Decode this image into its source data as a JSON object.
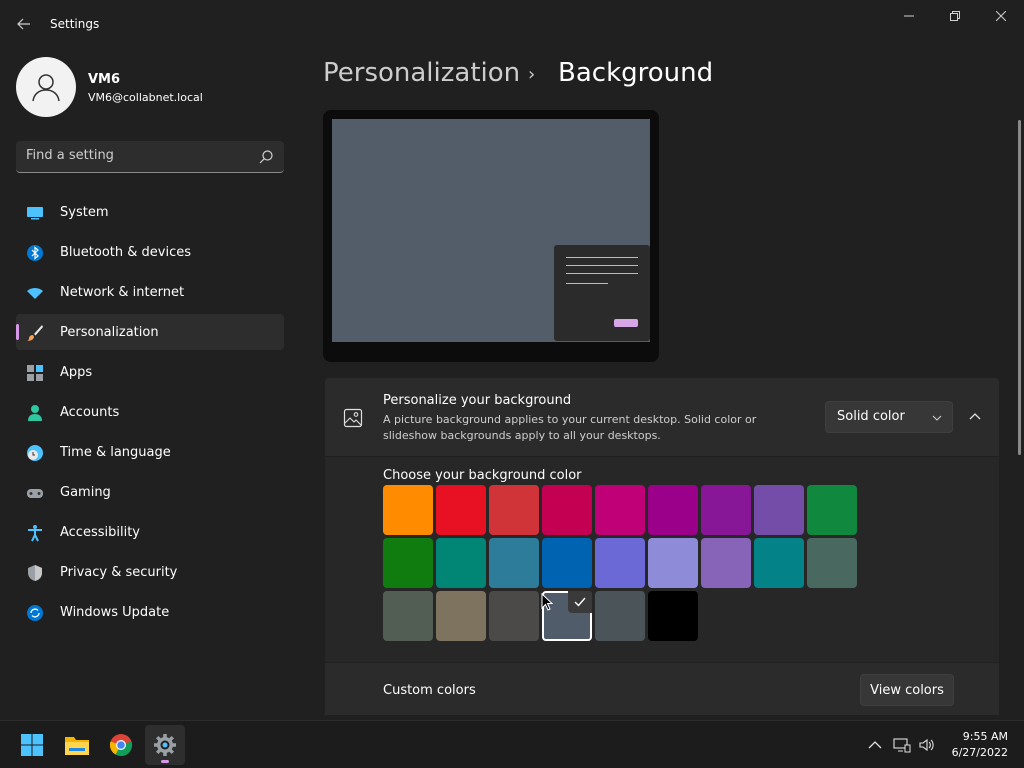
{
  "window": {
    "title": "Settings",
    "back_label": "←"
  },
  "user": {
    "name": "VM6",
    "email": "VM6@collabnet.local"
  },
  "search": {
    "placeholder": "Find a setting"
  },
  "nav": {
    "items": [
      {
        "label": "System",
        "icon": "system-icon"
      },
      {
        "label": "Bluetooth & devices",
        "icon": "bluetooth-icon"
      },
      {
        "label": "Network & internet",
        "icon": "network-icon"
      },
      {
        "label": "Personalization",
        "icon": "brush-icon",
        "active": true
      },
      {
        "label": "Apps",
        "icon": "apps-icon"
      },
      {
        "label": "Accounts",
        "icon": "accounts-icon"
      },
      {
        "label": "Time & language",
        "icon": "time-icon"
      },
      {
        "label": "Gaming",
        "icon": "gaming-icon"
      },
      {
        "label": "Accessibility",
        "icon": "accessibility-icon"
      },
      {
        "label": "Privacy & security",
        "icon": "shield-icon"
      },
      {
        "label": "Windows Update",
        "icon": "update-icon"
      }
    ]
  },
  "breadcrumb": {
    "parent": "Personalization",
    "separator": "›",
    "current": "Background"
  },
  "preview": {
    "background_color": "#525d69"
  },
  "background_card": {
    "title": "Personalize your background",
    "description": "A picture background applies to your current desktop. Solid color or slideshow backgrounds apply to all your desktops.",
    "dropdown_value": "Solid color",
    "choose_label": "Choose your background color",
    "colors": [
      [
        "#ff8c00",
        "#e81123",
        "#d13438",
        "#c30052",
        "#bf0077",
        "#9a0089",
        "#881798",
        "#744da9",
        "#10893e"
      ],
      [
        "#107c10",
        "#018574",
        "#2d7d9a",
        "#0063b1",
        "#6b69d6",
        "#8e8cd8",
        "#8764b8",
        "#038387",
        "#486860"
      ],
      [
        "#525e54",
        "#7e735f",
        "#4c4a48",
        "#515c6b",
        "#4a5459",
        "#000000"
      ]
    ],
    "selected_color": "#515c6b",
    "check_mark": "✓",
    "custom_label": "Custom colors",
    "view_colors_label": "View colors"
  },
  "taskbar": {
    "apps": [
      "start-icon",
      "file-explorer-icon",
      "chrome-icon",
      "settings-icon"
    ],
    "time": "9:55 AM",
    "date": "6/27/2022"
  }
}
